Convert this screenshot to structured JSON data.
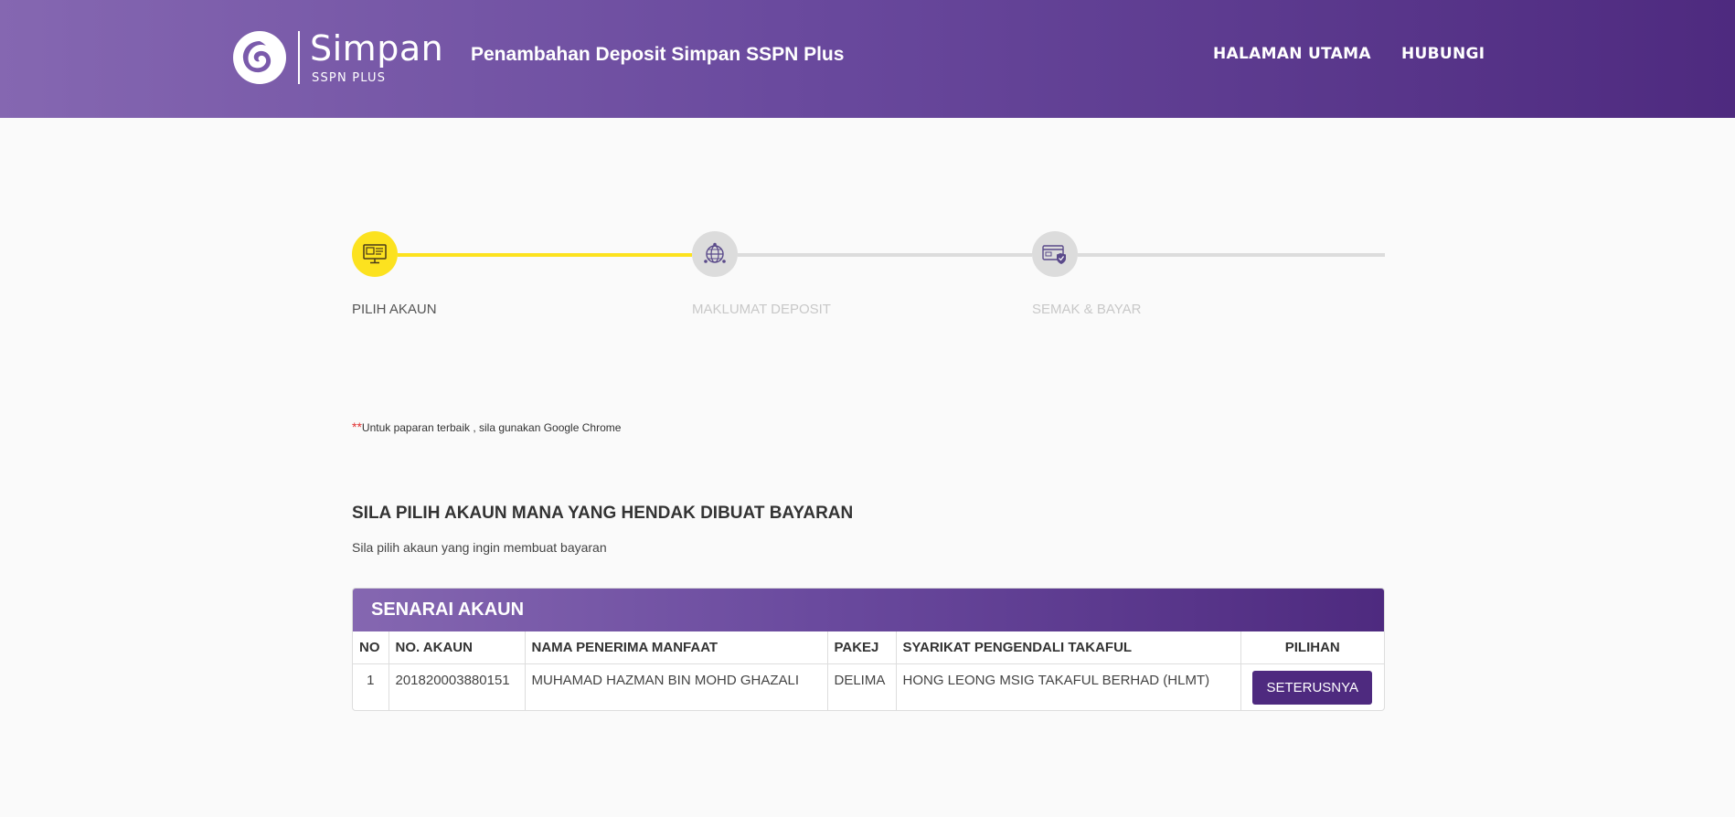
{
  "header": {
    "logo_name": "Simpan",
    "logo_sub": "SSPN PLUS",
    "title": "Penambahan Deposit Simpan SSPN Plus",
    "nav": {
      "home": "HALAMAN UTAMA",
      "contact": "HUBUNGI"
    }
  },
  "stepper": {
    "steps": [
      {
        "label": "PILIH AKAUN",
        "icon": "monitor-icon",
        "active": true
      },
      {
        "label": "MAKLUMAT DEPOSIT",
        "icon": "globe-icon",
        "active": false
      },
      {
        "label": "SEMAK & BAYAR",
        "icon": "card-shield-icon",
        "active": false
      }
    ],
    "active_color": "#fce21f",
    "inactive_color": "#dcdcdc"
  },
  "note": {
    "marker": "**",
    "text": "Untuk paparan terbaik , sila gunakan Google Chrome"
  },
  "section": {
    "title": "SILA PILIH AKAUN MANA YANG HENDAK DIBUAT BAYARAN",
    "subtitle": "Sila pilih akaun yang ingin membuat bayaran"
  },
  "accounts": {
    "title": "SENARAI AKAUN",
    "columns": [
      "NO",
      "NO. AKAUN",
      "NAMA PENERIMA MANFAAT",
      "PAKEJ",
      "SYARIKAT PENGENDALI TAKAFUL",
      "PILIHAN"
    ],
    "rows": [
      {
        "no": "1",
        "account": "201820003880151",
        "name": "MUHAMAD HAZMAN BIN MOHD GHAZALI",
        "package": "DELIMA",
        "company": "HONG LEONG MSIG TAKAFUL BERHAD (HLMT)",
        "action": "SETERUSNYA"
      }
    ]
  },
  "colors": {
    "brand": "#4e2a7f",
    "brand_light": "#8567b1"
  }
}
